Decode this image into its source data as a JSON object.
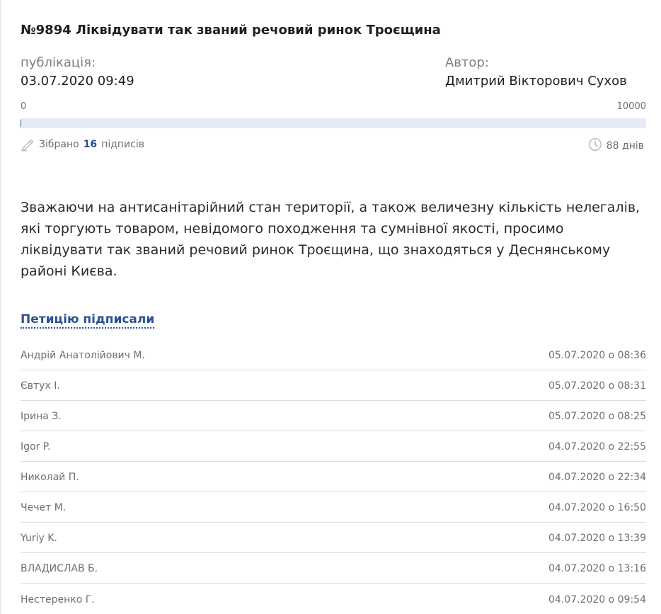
{
  "petition": {
    "title": "№9894 Ліквідувати так званий речовий ринок Троєщина",
    "publication_label": "публікація:",
    "publication_date": "03.07.2020 09:49",
    "author_label": "Автор:",
    "author_name": "Дмитрий Вікторович Сухов",
    "scale_min": "0",
    "scale_max": "10000",
    "progress_fraction": 0.0016,
    "collected_prefix": "Зібрано",
    "collected_count": "16",
    "collected_suffix": "підписів",
    "days_left": "88 днів",
    "text": "Зважаючи на антисанітарійний стан території, а також величезну кількість нелегалів, які торгують товаром, невідомого походження та сумнівної якості, просимо ліквідувати так званий речовий ринок Троєщина, що знаходяться у Деснянському районі Києва."
  },
  "signers_section": {
    "heading": "Петицію підписали",
    "rows": [
      {
        "name": "Андрій Анатолійович М.",
        "date": "05.07.2020 о 08:36"
      },
      {
        "name": "Євтух І.",
        "date": "05.07.2020 о 08:31"
      },
      {
        "name": "Ірина З.",
        "date": "05.07.2020 о 08:25"
      },
      {
        "name": "Igor P.",
        "date": "04.07.2020 о 22:55"
      },
      {
        "name": "Николай П.",
        "date": "04.07.2020 о 22:34"
      },
      {
        "name": "Чечет М.",
        "date": "04.07.2020 о 16:50"
      },
      {
        "name": "Yuriy K.",
        "date": "04.07.2020 о 13:39"
      },
      {
        "name": "ВЛАДИСЛАВ Б.",
        "date": "04.07.2020 о 13:16"
      },
      {
        "name": "Нестеренко Г.",
        "date": "04.07.2020 о 09:54"
      }
    ]
  },
  "colors": {
    "accent": "#2a5092",
    "progress_track": "#e6ecf6",
    "progress_fill": "#2a5db0",
    "muted_text": "#6b6f76"
  },
  "icons": {
    "collected": "pencil-icon",
    "days": "clock-icon"
  }
}
